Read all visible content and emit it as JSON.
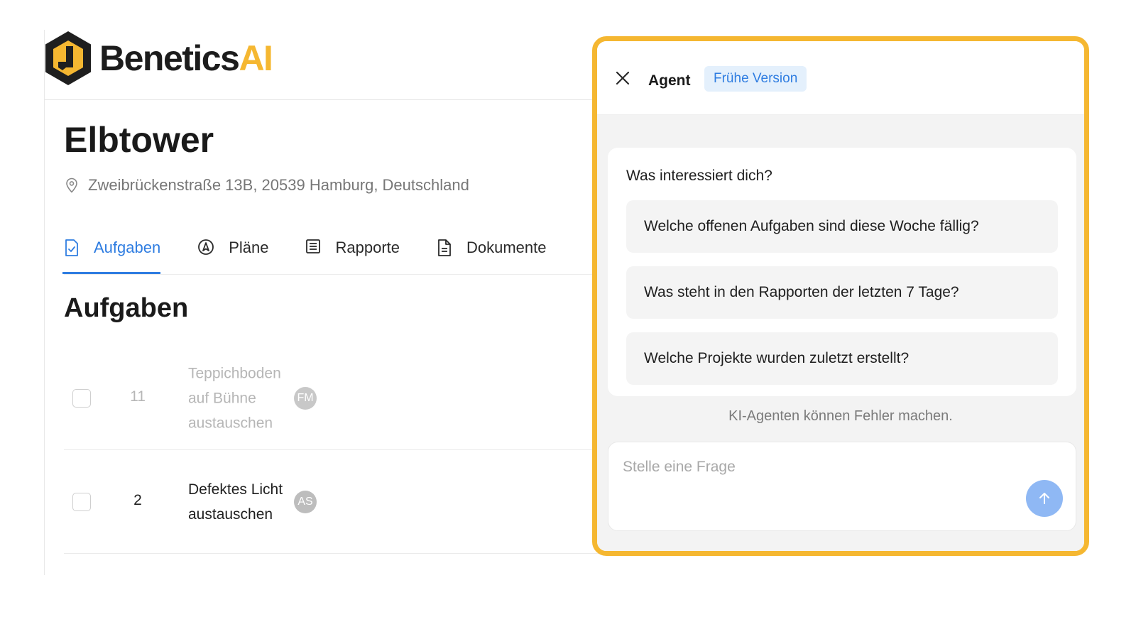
{
  "brand": {
    "name_main": "Benetics",
    "name_accent": "AI",
    "accent_color": "#f5b731"
  },
  "project": {
    "title": "Elbtower",
    "address": "Zweibrückenstraße 13B, 20539 Hamburg, Deutschland"
  },
  "tabs": [
    {
      "label": "Aufgaben",
      "icon": "task-check-icon",
      "active": true
    },
    {
      "label": "Pläne",
      "icon": "compass-icon",
      "active": false
    },
    {
      "label": "Rapporte",
      "icon": "report-icon",
      "active": false
    },
    {
      "label": "Dokumente",
      "icon": "document-icon",
      "active": false
    }
  ],
  "section": {
    "title": "Aufgaben"
  },
  "tasks": [
    {
      "number": "11",
      "title": "Teppichboden auf Bühne austauschen",
      "assignee": "FM",
      "done": true
    },
    {
      "number": "2",
      "title": "Defektes Licht austauschen",
      "assignee": "AS",
      "done": false
    }
  ],
  "agent": {
    "title": "Agent",
    "badge": "Frühe Version",
    "prompt": "Was interessiert dich?",
    "suggestions": [
      "Welche offenen Aufgaben sind diese Woche fällig?",
      "Was steht in den Rapporten der letzten 7 Tage?",
      "Welche Projekte wurden zuletzt erstellt?"
    ],
    "disclaimer": "KI-Agenten können Fehler machen.",
    "input_placeholder": "Stelle eine Frage"
  },
  "colors": {
    "primary": "#2f7de1",
    "highlight_border": "#f5b731",
    "send_button": "#8fb8f4"
  }
}
